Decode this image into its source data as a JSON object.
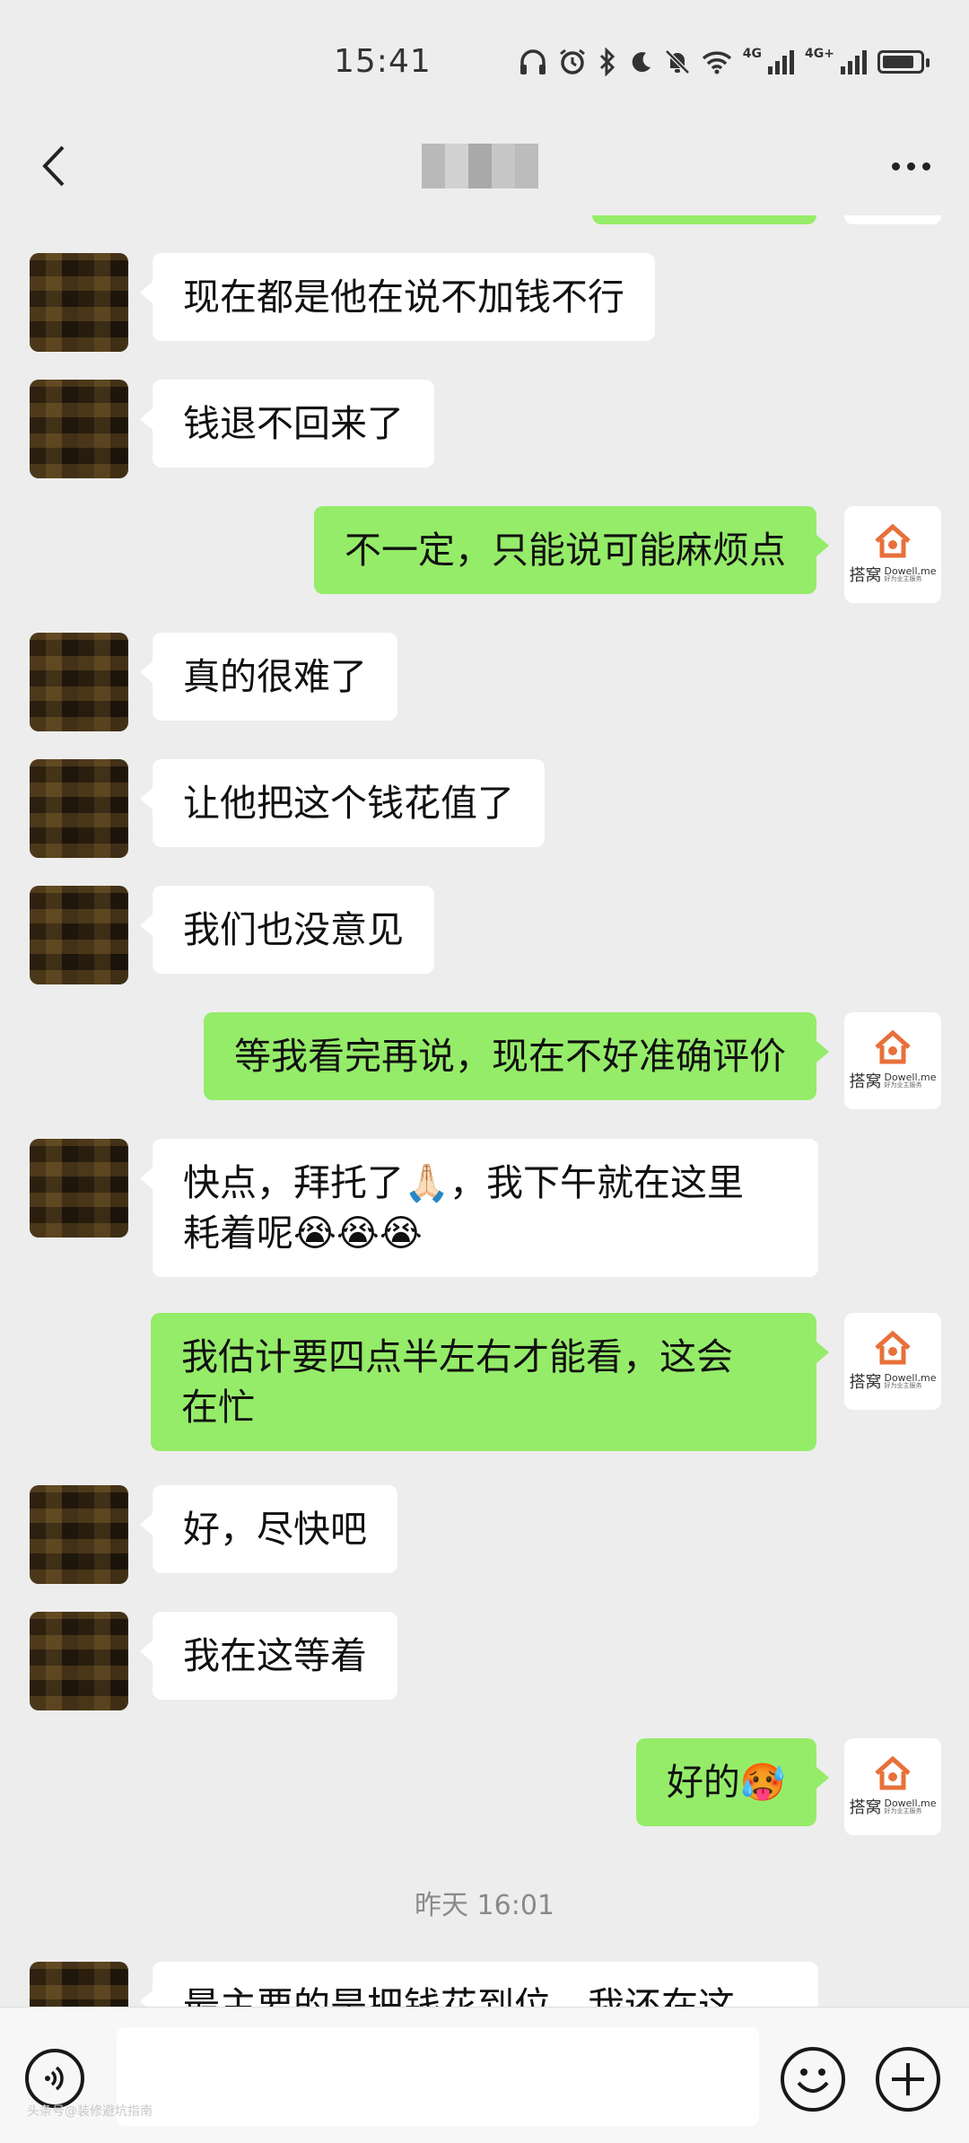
{
  "status_bar": {
    "time": "15:41",
    "net_labels": [
      "4G",
      "4G+"
    ],
    "battery_level": 0.85
  },
  "header": {
    "back_icon": "chevron-left-icon",
    "title_blurred": true,
    "more_icon": "more-dots-icon"
  },
  "contacts": {
    "self_avatar_brand_cn": "搭窝",
    "self_avatar_brand_en": "Dowell.me",
    "self_avatar_slogan": "好为业主服务"
  },
  "messages": [
    {
      "side": "left",
      "text": "现在都是他在说不加钱不行"
    },
    {
      "side": "left",
      "text": "钱退不回来了"
    },
    {
      "side": "right",
      "text": "不一定，只能说可能麻烦点"
    },
    {
      "side": "left",
      "text": "真的很难了"
    },
    {
      "side": "left",
      "text": "让他把这个钱花值了"
    },
    {
      "side": "left",
      "text": "我们也没意见"
    },
    {
      "side": "right",
      "text": "等我看完再说，现在不好准确评价"
    },
    {
      "side": "left",
      "line1": "快点，拜托了🙏🏻，我下午就在这里",
      "line2": "耗着呢😭😭😭"
    },
    {
      "side": "right",
      "line1": "我估计要四点半左右才能看，这会",
      "line2": "在忙"
    },
    {
      "side": "left",
      "text": "好，尽快吧"
    },
    {
      "side": "left",
      "text": "我在这等着"
    },
    {
      "side": "right",
      "text": "好的🥵"
    },
    {
      "side": "left",
      "text": "最主要的是把钱花到位，我还在这"
    }
  ],
  "timestamp": "昨天 16:01",
  "input_bar": {
    "voice_icon": "voice-icon",
    "emoji_icon": "emoji-icon",
    "plus_icon": "plus-icon",
    "placeholder": ""
  },
  "watermark": "头条号@装修避坑指南"
}
